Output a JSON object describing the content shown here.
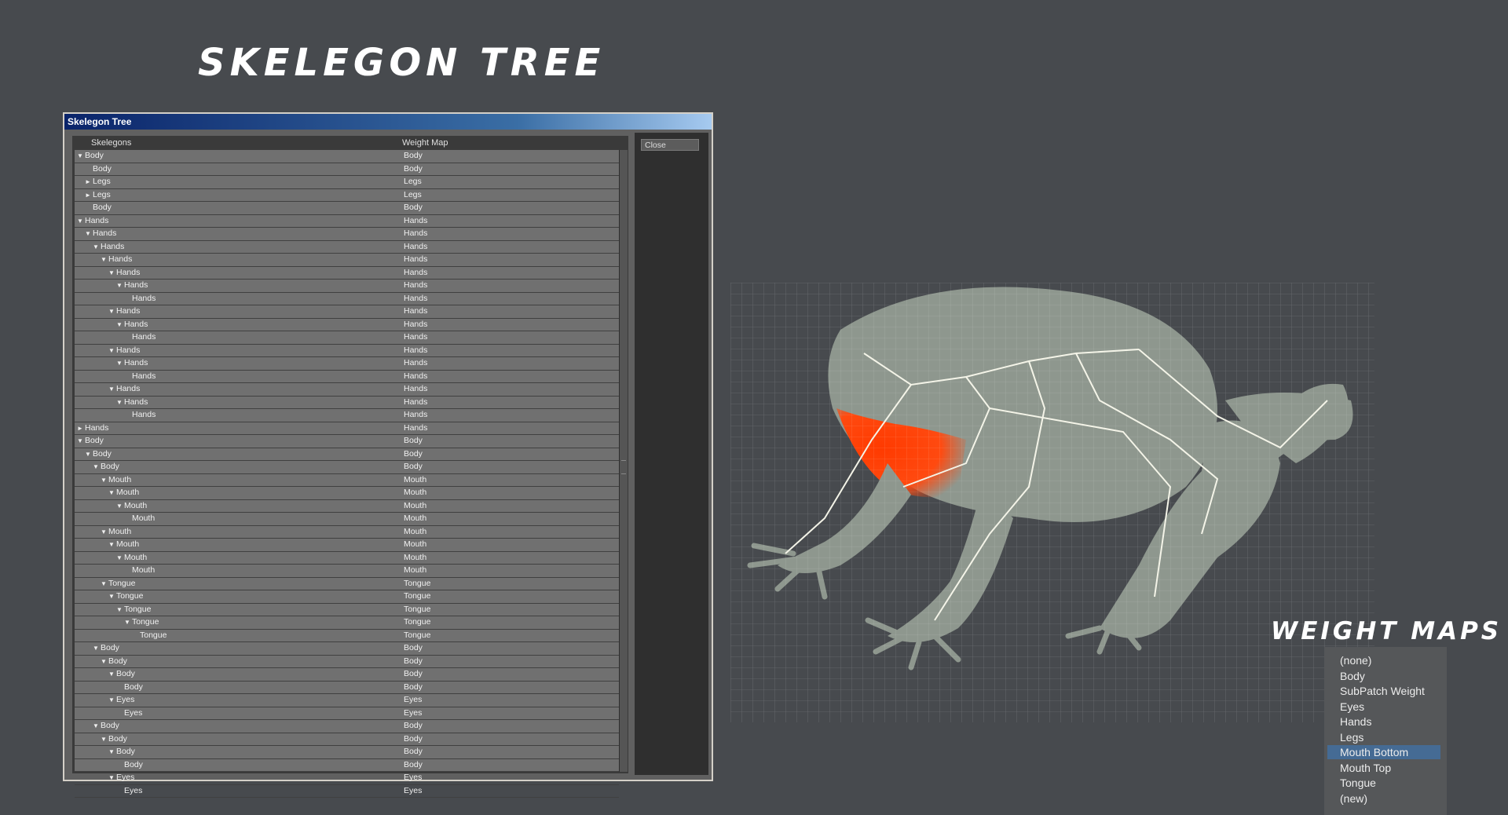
{
  "headline": "SKELEGON TREE",
  "weight_maps_heading": "WEIGHT MAPS",
  "window": {
    "title": "Skelegon Tree",
    "col_skelegons": "Skelegons",
    "col_weight_map": "Weight Map",
    "close_label": "Close"
  },
  "tree_rows": [
    {
      "tri": "▼",
      "d": 0,
      "name": "Body",
      "map": "Body"
    },
    {
      "tri": "",
      "d": 1,
      "name": "Body",
      "map": "Body"
    },
    {
      "tri": "►",
      "d": 1,
      "name": "Legs",
      "map": "Legs"
    },
    {
      "tri": "►",
      "d": 1,
      "name": "Legs",
      "map": "Legs"
    },
    {
      "tri": "",
      "d": 1,
      "name": "Body",
      "map": "Body"
    },
    {
      "tri": "▼",
      "d": 0,
      "name": "Hands",
      "map": "Hands"
    },
    {
      "tri": "▼",
      "d": 1,
      "name": "Hands",
      "map": "Hands"
    },
    {
      "tri": "▼",
      "d": 2,
      "name": "Hands",
      "map": "Hands"
    },
    {
      "tri": "▼",
      "d": 3,
      "name": "Hands",
      "map": "Hands"
    },
    {
      "tri": "▼",
      "d": 4,
      "name": "Hands",
      "map": "Hands"
    },
    {
      "tri": "▼",
      "d": 5,
      "name": "Hands",
      "map": "Hands"
    },
    {
      "tri": "",
      "d": 6,
      "name": "Hands",
      "map": "Hands"
    },
    {
      "tri": "▼",
      "d": 4,
      "name": "Hands",
      "map": "Hands"
    },
    {
      "tri": "▼",
      "d": 5,
      "name": "Hands",
      "map": "Hands"
    },
    {
      "tri": "",
      "d": 6,
      "name": "Hands",
      "map": "Hands"
    },
    {
      "tri": "▼",
      "d": 4,
      "name": "Hands",
      "map": "Hands"
    },
    {
      "tri": "▼",
      "d": 5,
      "name": "Hands",
      "map": "Hands"
    },
    {
      "tri": "",
      "d": 6,
      "name": "Hands",
      "map": "Hands"
    },
    {
      "tri": "▼",
      "d": 4,
      "name": "Hands",
      "map": "Hands"
    },
    {
      "tri": "▼",
      "d": 5,
      "name": "Hands",
      "map": "Hands"
    },
    {
      "tri": "",
      "d": 6,
      "name": "Hands",
      "map": "Hands"
    },
    {
      "tri": "►",
      "d": 0,
      "name": "Hands",
      "map": "Hands"
    },
    {
      "tri": "▼",
      "d": 0,
      "name": "Body",
      "map": "Body"
    },
    {
      "tri": "▼",
      "d": 1,
      "name": "Body",
      "map": "Body"
    },
    {
      "tri": "▼",
      "d": 2,
      "name": "Body",
      "map": "Body"
    },
    {
      "tri": "▼",
      "d": 3,
      "name": "Mouth",
      "map": "Mouth"
    },
    {
      "tri": "▼",
      "d": 4,
      "name": "Mouth",
      "map": "Mouth"
    },
    {
      "tri": "▼",
      "d": 5,
      "name": "Mouth",
      "map": "Mouth"
    },
    {
      "tri": "",
      "d": 6,
      "name": "Mouth",
      "map": "Mouth"
    },
    {
      "tri": "▼",
      "d": 3,
      "name": "Mouth",
      "map": "Mouth"
    },
    {
      "tri": "▼",
      "d": 4,
      "name": "Mouth",
      "map": "Mouth"
    },
    {
      "tri": "▼",
      "d": 5,
      "name": "Mouth",
      "map": "Mouth"
    },
    {
      "tri": "",
      "d": 6,
      "name": "Mouth",
      "map": "Mouth"
    },
    {
      "tri": "▼",
      "d": 3,
      "name": "Tongue",
      "map": "Tongue"
    },
    {
      "tri": "▼",
      "d": 4,
      "name": "Tongue",
      "map": "Tongue"
    },
    {
      "tri": "▼",
      "d": 5,
      "name": "Tongue",
      "map": "Tongue"
    },
    {
      "tri": "▼",
      "d": 6,
      "name": "Tongue",
      "map": "Tongue"
    },
    {
      "tri": "",
      "d": 7,
      "name": "Tongue",
      "map": "Tongue"
    },
    {
      "tri": "▼",
      "d": 2,
      "name": "Body",
      "map": "Body"
    },
    {
      "tri": "▼",
      "d": 3,
      "name": "Body",
      "map": "Body"
    },
    {
      "tri": "▼",
      "d": 4,
      "name": "Body",
      "map": "Body"
    },
    {
      "tri": "",
      "d": 5,
      "name": "Body",
      "map": "Body"
    },
    {
      "tri": "▼",
      "d": 4,
      "name": "Eyes",
      "map": "Eyes"
    },
    {
      "tri": "",
      "d": 5,
      "name": "Eyes",
      "map": "Eyes"
    },
    {
      "tri": "▼",
      "d": 2,
      "name": "Body",
      "map": "Body"
    },
    {
      "tri": "▼",
      "d": 3,
      "name": "Body",
      "map": "Body"
    },
    {
      "tri": "▼",
      "d": 4,
      "name": "Body",
      "map": "Body"
    },
    {
      "tri": "",
      "d": 5,
      "name": "Body",
      "map": "Body"
    },
    {
      "tri": "▼",
      "d": 4,
      "name": "Eyes",
      "map": "Eyes"
    },
    {
      "tri": "",
      "d": 5,
      "name": "Eyes",
      "map": "Eyes"
    }
  ],
  "weight_maps": {
    "items": [
      "(none)",
      "Body",
      "SubPatch Weight",
      "Eyes",
      "Hands",
      "Legs",
      "Mouth Bottom",
      "Mouth Top",
      "Tongue",
      "(new)"
    ],
    "selected": "Mouth Bottom",
    "selected_color": "#456b94"
  },
  "colors": {
    "background": "#474a4e",
    "frog_skin": "#8e978e",
    "mouth_weight": "#ff3a00"
  }
}
